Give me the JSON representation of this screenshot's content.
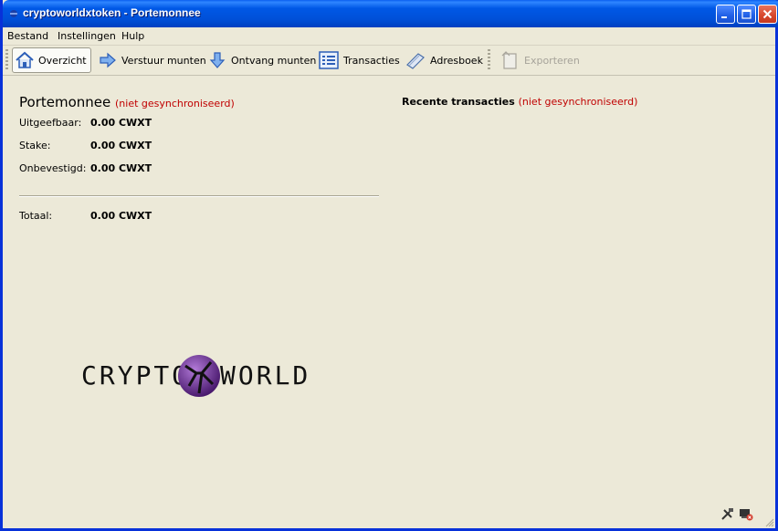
{
  "window": {
    "title": "cryptoworldxtoken - Portemonnee",
    "controls": {
      "minimize": "minimize-icon",
      "maximize": "maximize-icon",
      "close": "close-icon"
    }
  },
  "menu": {
    "items": [
      "Bestand",
      "Instellingen",
      "Hulp"
    ]
  },
  "toolbar": {
    "items": [
      {
        "label": "Overzicht",
        "icon": "home-icon",
        "state": "active"
      },
      {
        "label": "Verstuur munten",
        "icon": "send-arrow-icon",
        "state": "normal"
      },
      {
        "label": "Ontvang munten",
        "icon": "receive-arrow-icon",
        "state": "normal"
      },
      {
        "label": "Transacties",
        "icon": "transactions-list-icon",
        "state": "normal"
      },
      {
        "label": "Adresboek",
        "icon": "address-book-icon",
        "state": "normal"
      },
      {
        "label": "Exporteren",
        "icon": "export-icon",
        "state": "disabled"
      }
    ]
  },
  "wallet": {
    "title": "Portemonnee",
    "sync_status": "(niet gesynchroniseerd)",
    "rows": [
      {
        "label": "Uitgeefbaar:",
        "value": "0.00 CWXT"
      },
      {
        "label": "Stake:",
        "value": "0.00 CWXT"
      },
      {
        "label": "Onbevestigd:",
        "value": "0.00 CWXT"
      }
    ],
    "total": {
      "label": "Totaal:",
      "value": "0.00 CWXT"
    }
  },
  "recent": {
    "title": "Recente transacties",
    "sync_status": "(niet gesynchroniseerd)"
  },
  "logo": {
    "text_left": "CRYPTO",
    "text_right": "WORLD"
  },
  "status": {
    "icons": [
      "staking-tools-icon",
      "network-offline-icon"
    ]
  },
  "colors": {
    "warning_text": "#c00000",
    "window_bg": "#ece9d8",
    "title_blue": "#0058e6"
  }
}
